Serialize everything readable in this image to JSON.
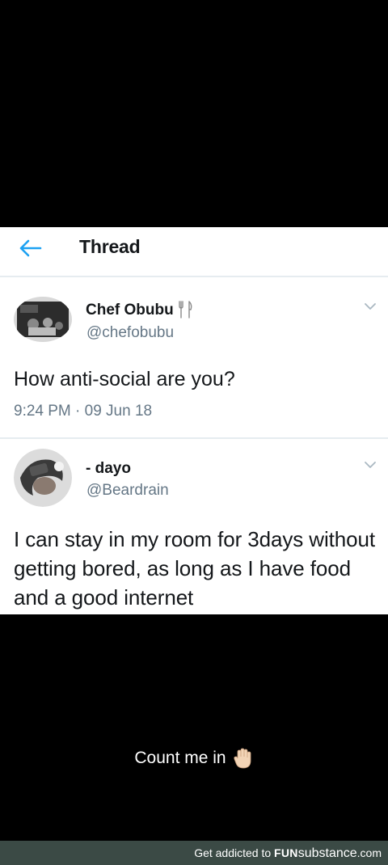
{
  "header": {
    "back_icon": "arrow-left-icon",
    "title": "Thread"
  },
  "tweets": [
    {
      "display_name": "Chef Obubu",
      "name_emoji": "fork-and-knife-icon",
      "handle": "@chefobubu",
      "text": "How anti-social are you?",
      "meta": "9:24 PM · 09 Jun 18"
    },
    {
      "display_name": "- dayo",
      "handle": "@Beardrain",
      "text": "I can stay in my room for 3days without getting bored, as long as I have food and a good internet"
    }
  ],
  "caption": {
    "text": "Count me in",
    "emoji": "raised-hand-icon"
  },
  "watermark": {
    "prefix": "Get addicted to ",
    "brand_bold": "FUN",
    "brand_rest": "substance",
    "suffix": ".com"
  },
  "colors": {
    "background": "#000000",
    "card": "#ffffff",
    "accent_blue": "#1da1f2",
    "muted_text": "#657786",
    "watermark_bar": "#3b4a45"
  }
}
